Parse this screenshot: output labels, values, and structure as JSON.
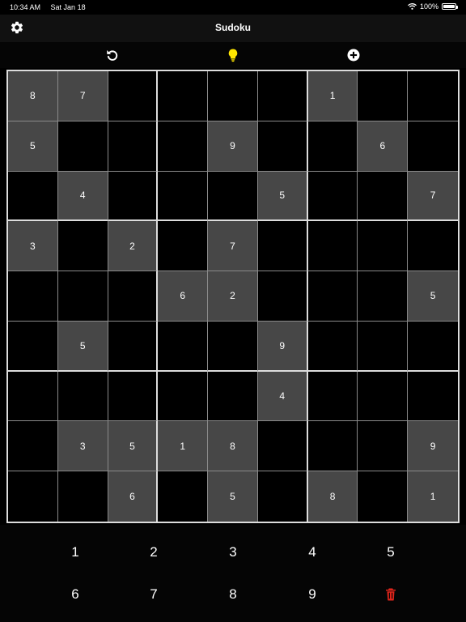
{
  "status_bar": {
    "time": "10:34 AM",
    "date": "Sat Jan 18",
    "battery": "100%"
  },
  "nav": {
    "title": "Sudoku"
  },
  "icons": {
    "settings": "gear-icon",
    "undo": "undo-icon",
    "hint": "lightbulb-icon",
    "new_game": "plus-circle-icon",
    "delete": "trash-icon"
  },
  "colors": {
    "hint": "#ffe600",
    "delete": "#e0251b",
    "given_cell": "#474747",
    "background": "#000000"
  },
  "board": [
    [
      "8",
      "7",
      "",
      "",
      "",
      "",
      "1",
      "",
      ""
    ],
    [
      "5",
      "",
      "",
      "",
      "9",
      "",
      "",
      "6",
      ""
    ],
    [
      "",
      "4",
      "",
      "",
      "",
      "5",
      "",
      "",
      "7"
    ],
    [
      "3",
      "",
      "2",
      "",
      "7",
      "",
      "",
      "",
      ""
    ],
    [
      "",
      "",
      "",
      "6",
      "2",
      "",
      "",
      "",
      "5"
    ],
    [
      "",
      "5",
      "",
      "",
      "",
      "9",
      "",
      "",
      ""
    ],
    [
      "",
      "",
      "",
      "",
      "",
      "4",
      "",
      "",
      ""
    ],
    [
      "",
      "3",
      "5",
      "1",
      "8",
      "",
      "",
      "",
      "9"
    ],
    [
      "",
      "",
      "6",
      "",
      "5",
      "",
      "8",
      "",
      "1"
    ]
  ],
  "numpad": {
    "row1": [
      "1",
      "2",
      "3",
      "4",
      "5"
    ],
    "row2": [
      "6",
      "7",
      "8",
      "9"
    ]
  }
}
